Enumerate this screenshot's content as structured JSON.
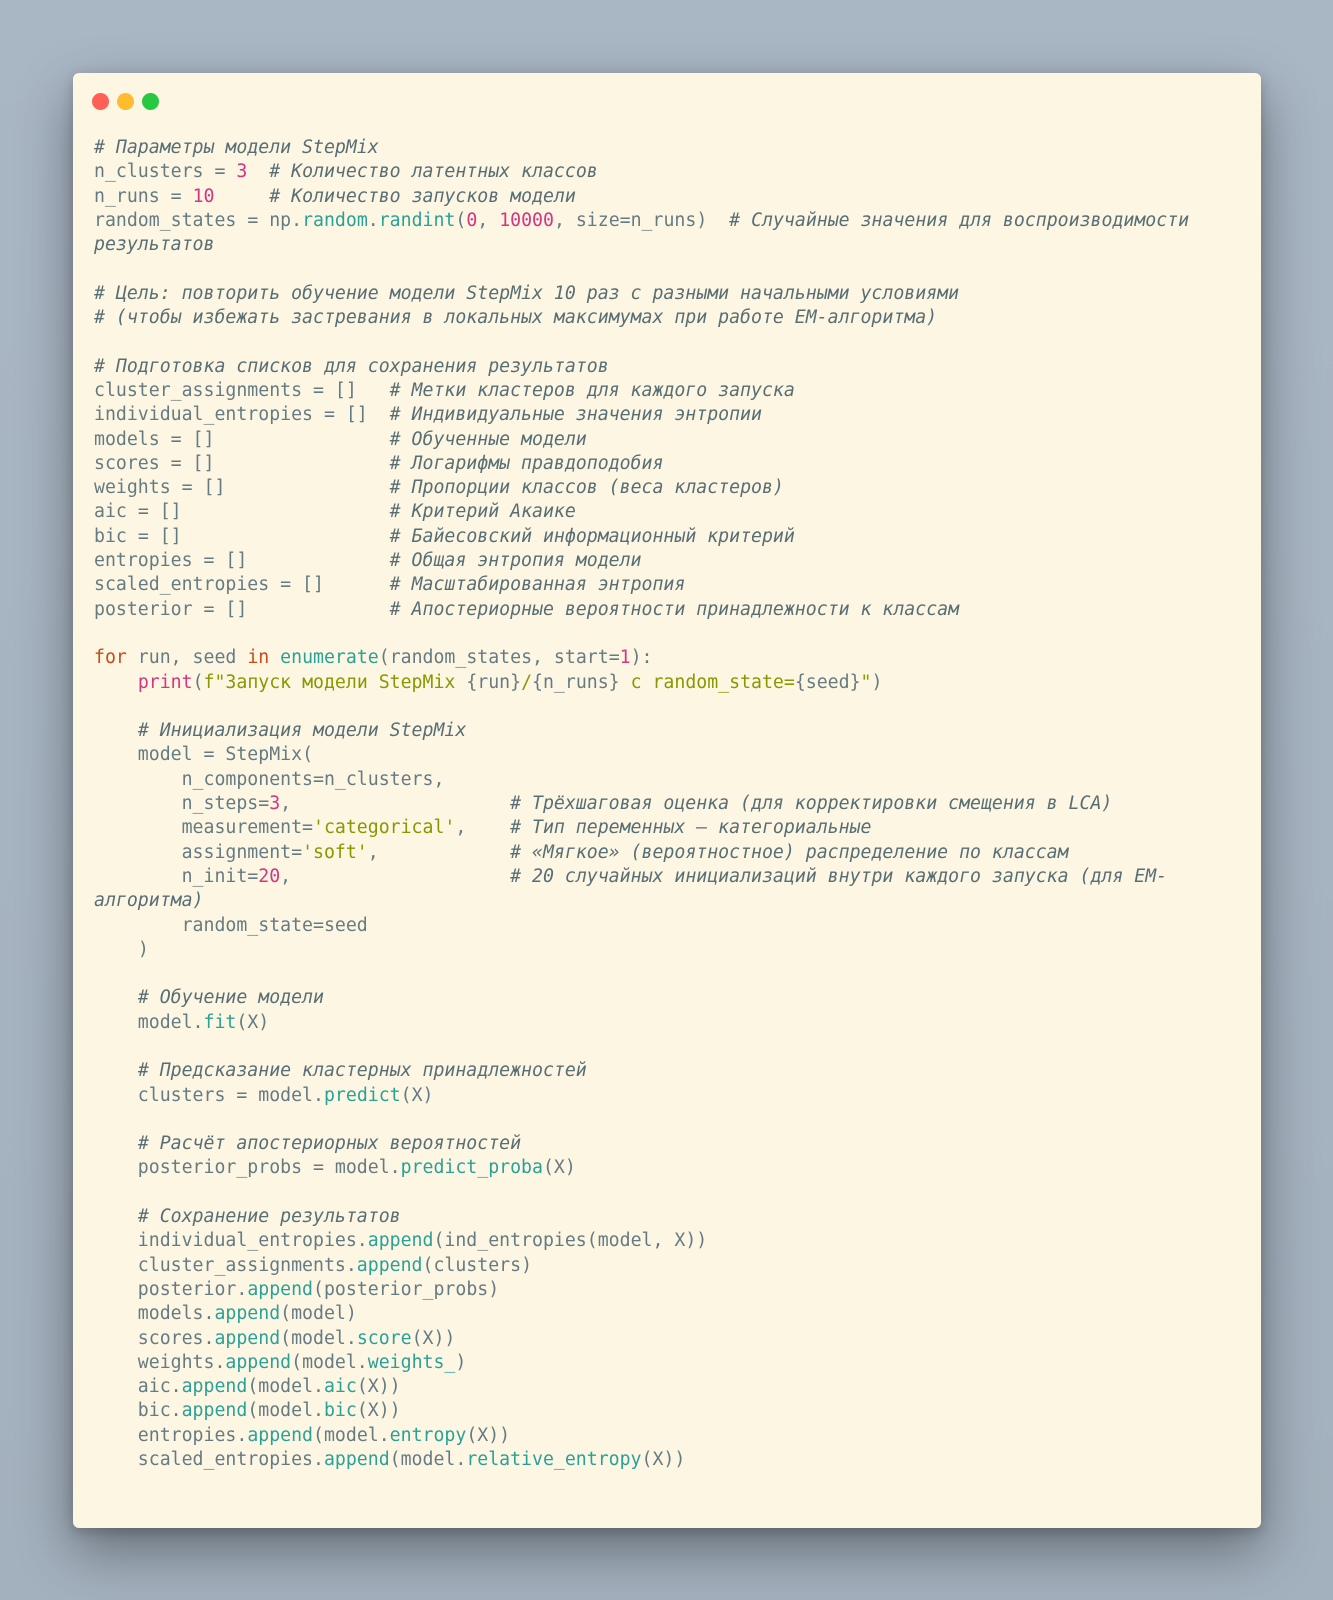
{
  "window": {
    "controls": [
      {
        "name": "close",
        "color": "#fe5f57"
      },
      {
        "name": "minimize",
        "color": "#febc2e"
      },
      {
        "name": "maximize",
        "color": "#28c840"
      }
    ]
  },
  "code": {
    "lines": [
      [
        [
          "cm",
          "# Параметры модели StepMix"
        ]
      ],
      [
        [
          "tx",
          "n_clusters "
        ],
        [
          "op",
          "="
        ],
        [
          "tx",
          " "
        ],
        [
          "nm",
          "3"
        ],
        [
          "tx",
          "  "
        ],
        [
          "cm",
          "# Количество латентных классов"
        ]
      ],
      [
        [
          "tx",
          "n_runs "
        ],
        [
          "op",
          "="
        ],
        [
          "tx",
          " "
        ],
        [
          "nm",
          "10"
        ],
        [
          "tx",
          "     "
        ],
        [
          "cm",
          "# Количество запусков модели"
        ]
      ],
      [
        [
          "tx",
          "random_states "
        ],
        [
          "op",
          "="
        ],
        [
          "tx",
          " np."
        ],
        [
          "fn",
          "random"
        ],
        [
          "tx",
          "."
        ],
        [
          "fn",
          "randint"
        ],
        [
          "pn",
          "("
        ],
        [
          "nm",
          "0"
        ],
        [
          "tx",
          ", "
        ],
        [
          "nm",
          "10000"
        ],
        [
          "tx",
          ", size"
        ],
        [
          "op",
          "="
        ],
        [
          "tx",
          "n_runs"
        ],
        [
          "pn",
          ")"
        ],
        [
          "tx",
          "  "
        ],
        [
          "cm",
          "# Случайные значения для воспроизводимости"
        ]
      ],
      [
        [
          "cm",
          "результатов"
        ]
      ],
      [],
      [
        [
          "cm",
          "# Цель: повторить обучение модели StepMix 10 раз с разными начальными условиями"
        ]
      ],
      [
        [
          "cm",
          "# (чтобы избежать застревания в локальных максимумах при работе EM-алгоритма)"
        ]
      ],
      [],
      [
        [
          "cm",
          "# Подготовка списков для сохранения результатов"
        ]
      ],
      [
        [
          "tx",
          "cluster_assignments "
        ],
        [
          "op",
          "="
        ],
        [
          "tx",
          " []   "
        ],
        [
          "cm",
          "# Метки кластеров для каждого запуска"
        ]
      ],
      [
        [
          "tx",
          "individual_entropies "
        ],
        [
          "op",
          "="
        ],
        [
          "tx",
          " []  "
        ],
        [
          "cm",
          "# Индивидуальные значения энтропии"
        ]
      ],
      [
        [
          "tx",
          "models "
        ],
        [
          "op",
          "="
        ],
        [
          "tx",
          " []                "
        ],
        [
          "cm",
          "# Обученные модели"
        ]
      ],
      [
        [
          "tx",
          "scores "
        ],
        [
          "op",
          "="
        ],
        [
          "tx",
          " []                "
        ],
        [
          "cm",
          "# Логарифмы правдоподобия"
        ]
      ],
      [
        [
          "tx",
          "weights "
        ],
        [
          "op",
          "="
        ],
        [
          "tx",
          " []               "
        ],
        [
          "cm",
          "# Пропорции классов (веса кластеров)"
        ]
      ],
      [
        [
          "tx",
          "aic "
        ],
        [
          "op",
          "="
        ],
        [
          "tx",
          " []                   "
        ],
        [
          "cm",
          "# Критерий Акаике"
        ]
      ],
      [
        [
          "tx",
          "bic "
        ],
        [
          "op",
          "="
        ],
        [
          "tx",
          " []                   "
        ],
        [
          "cm",
          "# Байесовский информационный критерий"
        ]
      ],
      [
        [
          "tx",
          "entropies "
        ],
        [
          "op",
          "="
        ],
        [
          "tx",
          " []             "
        ],
        [
          "cm",
          "# Общая энтропия модели"
        ]
      ],
      [
        [
          "tx",
          "scaled_entropies "
        ],
        [
          "op",
          "="
        ],
        [
          "tx",
          " []      "
        ],
        [
          "cm",
          "# Масштабированная энтропия"
        ]
      ],
      [
        [
          "tx",
          "posterior "
        ],
        [
          "op",
          "="
        ],
        [
          "tx",
          " []             "
        ],
        [
          "cm",
          "# Апостериорные вероятности принадлежности к классам"
        ]
      ],
      [],
      [
        [
          "kw",
          "for"
        ],
        [
          "tx",
          " run, seed "
        ],
        [
          "kw",
          "in"
        ],
        [
          "tx",
          " "
        ],
        [
          "fn",
          "enumerate"
        ],
        [
          "pn",
          "("
        ],
        [
          "tx",
          "random_states, start"
        ],
        [
          "op",
          "="
        ],
        [
          "nm",
          "1"
        ],
        [
          "pn",
          ")"
        ],
        [
          "tx",
          ":"
        ]
      ],
      [
        [
          "tx",
          "    "
        ],
        [
          "bi",
          "print"
        ],
        [
          "pn",
          "("
        ],
        [
          "st",
          "f\"Запуск модели StepMix "
        ],
        [
          "tx",
          "{run}"
        ],
        [
          "st",
          "/"
        ],
        [
          "tx",
          "{n_runs}"
        ],
        [
          "st",
          " с random_state="
        ],
        [
          "tx",
          "{seed}"
        ],
        [
          "st",
          "\""
        ],
        [
          "pn",
          ")"
        ]
      ],
      [],
      [
        [
          "tx",
          "    "
        ],
        [
          "cm",
          "# Инициализация модели StepMix"
        ]
      ],
      [
        [
          "tx",
          "    model "
        ],
        [
          "op",
          "="
        ],
        [
          "tx",
          " StepMix"
        ],
        [
          "pn",
          "("
        ]
      ],
      [
        [
          "tx",
          "        n_components"
        ],
        [
          "op",
          "="
        ],
        [
          "tx",
          "n_clusters,"
        ]
      ],
      [
        [
          "tx",
          "        n_steps"
        ],
        [
          "op",
          "="
        ],
        [
          "nm",
          "3"
        ],
        [
          "tx",
          ",                    "
        ],
        [
          "cm",
          "# Трёхшаговая оценка (для корректировки смещения в LCA)"
        ]
      ],
      [
        [
          "tx",
          "        measurement"
        ],
        [
          "op",
          "="
        ],
        [
          "st",
          "'categorical'"
        ],
        [
          "tx",
          ",    "
        ],
        [
          "cm",
          "# Тип переменных — категориальные"
        ]
      ],
      [
        [
          "tx",
          "        assignment"
        ],
        [
          "op",
          "="
        ],
        [
          "st",
          "'soft'"
        ],
        [
          "tx",
          ",            "
        ],
        [
          "cm",
          "# «Мягкое» (вероятностное) распределение по классам"
        ]
      ],
      [
        [
          "tx",
          "        n_init"
        ],
        [
          "op",
          "="
        ],
        [
          "nm",
          "20"
        ],
        [
          "tx",
          ",                    "
        ],
        [
          "cm",
          "# 20 случайных инициализаций внутри каждого запуска (для EM-"
        ]
      ],
      [
        [
          "cm",
          "алгоритма)"
        ]
      ],
      [
        [
          "tx",
          "        random_state"
        ],
        [
          "op",
          "="
        ],
        [
          "tx",
          "seed"
        ]
      ],
      [
        [
          "tx",
          "    "
        ],
        [
          "pn",
          ")"
        ]
      ],
      [],
      [
        [
          "tx",
          "    "
        ],
        [
          "cm",
          "# Обучение модели"
        ]
      ],
      [
        [
          "tx",
          "    model."
        ],
        [
          "fn",
          "fit"
        ],
        [
          "pn",
          "("
        ],
        [
          "tx",
          "X"
        ],
        [
          "pn",
          ")"
        ]
      ],
      [],
      [
        [
          "tx",
          "    "
        ],
        [
          "cm",
          "# Предсказание кластерных принадлежностей"
        ]
      ],
      [
        [
          "tx",
          "    clusters "
        ],
        [
          "op",
          "="
        ],
        [
          "tx",
          " model."
        ],
        [
          "fn",
          "predict"
        ],
        [
          "pn",
          "("
        ],
        [
          "tx",
          "X"
        ],
        [
          "pn",
          ")"
        ]
      ],
      [],
      [
        [
          "tx",
          "    "
        ],
        [
          "cm",
          "# Расчёт апостериорных вероятностей"
        ]
      ],
      [
        [
          "tx",
          "    posterior_probs "
        ],
        [
          "op",
          "="
        ],
        [
          "tx",
          " model."
        ],
        [
          "fn",
          "predict_proba"
        ],
        [
          "pn",
          "("
        ],
        [
          "tx",
          "X"
        ],
        [
          "pn",
          ")"
        ]
      ],
      [],
      [
        [
          "tx",
          "    "
        ],
        [
          "cm",
          "# Сохранение результатов"
        ]
      ],
      [
        [
          "tx",
          "    individual_entropies."
        ],
        [
          "fn",
          "append"
        ],
        [
          "pn",
          "("
        ],
        [
          "tx",
          "ind_entropies"
        ],
        [
          "pn",
          "("
        ],
        [
          "tx",
          "model, X"
        ],
        [
          "pn",
          "))"
        ]
      ],
      [
        [
          "tx",
          "    cluster_assignments."
        ],
        [
          "fn",
          "append"
        ],
        [
          "pn",
          "("
        ],
        [
          "tx",
          "clusters"
        ],
        [
          "pn",
          ")"
        ]
      ],
      [
        [
          "tx",
          "    posterior."
        ],
        [
          "fn",
          "append"
        ],
        [
          "pn",
          "("
        ],
        [
          "tx",
          "posterior_probs"
        ],
        [
          "pn",
          ")"
        ]
      ],
      [
        [
          "tx",
          "    models."
        ],
        [
          "fn",
          "append"
        ],
        [
          "pn",
          "("
        ],
        [
          "tx",
          "model"
        ],
        [
          "pn",
          ")"
        ]
      ],
      [
        [
          "tx",
          "    scores."
        ],
        [
          "fn",
          "append"
        ],
        [
          "pn",
          "("
        ],
        [
          "tx",
          "model."
        ],
        [
          "fn",
          "score"
        ],
        [
          "pn",
          "("
        ],
        [
          "tx",
          "X"
        ],
        [
          "pn",
          "))"
        ]
      ],
      [
        [
          "tx",
          "    weights."
        ],
        [
          "fn",
          "append"
        ],
        [
          "pn",
          "("
        ],
        [
          "tx",
          "model."
        ],
        [
          "fn",
          "weights_"
        ],
        [
          "pn",
          ")"
        ]
      ],
      [
        [
          "tx",
          "    aic."
        ],
        [
          "fn",
          "append"
        ],
        [
          "pn",
          "("
        ],
        [
          "tx",
          "model."
        ],
        [
          "fn",
          "aic"
        ],
        [
          "pn",
          "("
        ],
        [
          "tx",
          "X"
        ],
        [
          "pn",
          "))"
        ]
      ],
      [
        [
          "tx",
          "    bic."
        ],
        [
          "fn",
          "append"
        ],
        [
          "pn",
          "("
        ],
        [
          "tx",
          "model."
        ],
        [
          "fn",
          "bic"
        ],
        [
          "pn",
          "("
        ],
        [
          "tx",
          "X"
        ],
        [
          "pn",
          "))"
        ]
      ],
      [
        [
          "tx",
          "    entropies."
        ],
        [
          "fn",
          "append"
        ],
        [
          "pn",
          "("
        ],
        [
          "tx",
          "model."
        ],
        [
          "fn",
          "entropy"
        ],
        [
          "pn",
          "("
        ],
        [
          "tx",
          "X"
        ],
        [
          "pn",
          "))"
        ]
      ],
      [
        [
          "tx",
          "    scaled_entropies."
        ],
        [
          "fn",
          "append"
        ],
        [
          "pn",
          "("
        ],
        [
          "tx",
          "model."
        ],
        [
          "fn",
          "relative_entropy"
        ],
        [
          "pn",
          "("
        ],
        [
          "tx",
          "X"
        ],
        [
          "pn",
          "))"
        ]
      ]
    ]
  }
}
